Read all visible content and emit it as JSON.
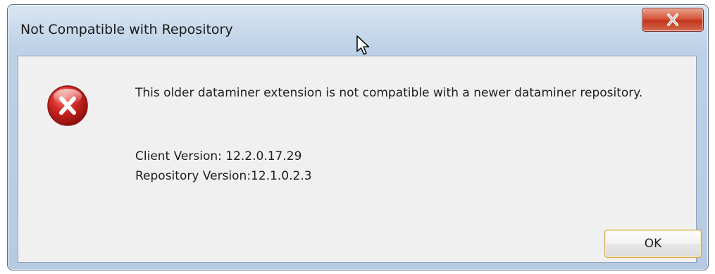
{
  "window": {
    "title": "Not Compatible with Repository",
    "close_label": "x"
  },
  "dialog": {
    "icon": "error-icon",
    "icon_color": "#d42a26",
    "message": "This older dataminer extension is not compatible with a newer dataminer repository.",
    "client_version_line": "Client Version: 12.2.0.17.29",
    "repository_version_line": "Repository Version:12.1.0.2.3",
    "ok_label": "OK"
  }
}
